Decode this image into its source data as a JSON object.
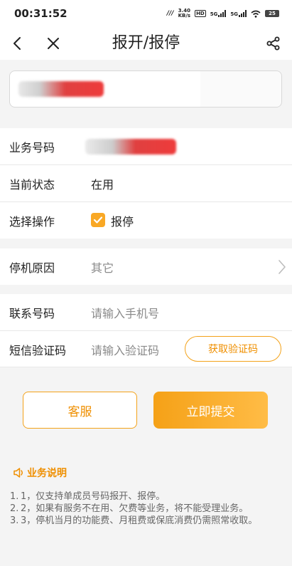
{
  "status_bar": {
    "time": "00:31:52",
    "net_speed": "3.40",
    "net_unit": "KB/s",
    "hd_badge": "HD",
    "sim1_label": "5G",
    "sim2_label": "5G",
    "battery": "25"
  },
  "nav": {
    "title": "报开/报停"
  },
  "form": {
    "business_number_label": "业务号码",
    "current_status_label": "当前状态",
    "current_status_value": "在用",
    "select_operation_label": "选择操作",
    "operation_option_label": "报停",
    "operation_checked": true,
    "stop_reason_label": "停机原因",
    "stop_reason_value": "其它",
    "contact_number_label": "联系号码",
    "contact_number_placeholder": "请输入手机号",
    "sms_code_label": "短信验证码",
    "sms_code_placeholder": "请输入验证码",
    "get_code_button": "获取验证码"
  },
  "actions": {
    "customer_service": "客服",
    "submit": "立即提交"
  },
  "description": {
    "title": "业务说明",
    "items": [
      {
        "num": "1.",
        "text": "1，仅支持单成员号码报开、报停。"
      },
      {
        "num": "2.",
        "text": "2，如果有服务不在用、欠费等业务，将不能受理业务。"
      },
      {
        "num": "3.",
        "text": "3，停机当月的功能费、月租费或保底消费仍需照常收取。"
      }
    ]
  },
  "colors": {
    "accent": "#f3a21a",
    "accent_text": "#ef8f00",
    "checkbox": "#f9a825"
  }
}
